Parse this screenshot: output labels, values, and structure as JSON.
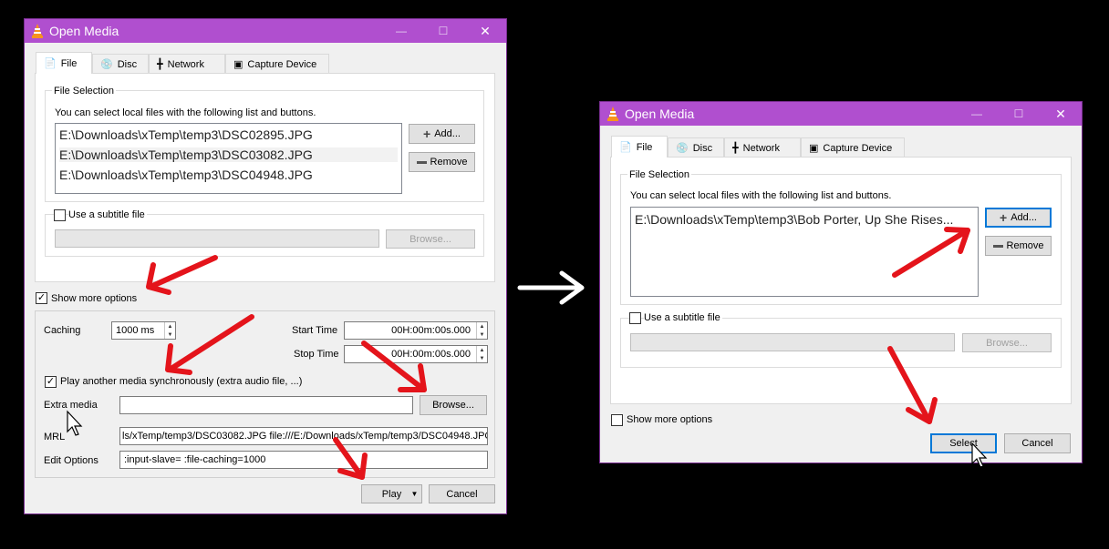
{
  "left": {
    "title": "Open Media",
    "tabs": [
      {
        "label": "File",
        "icon": "file-icon"
      },
      {
        "label": "Disc",
        "icon": "disc-icon"
      },
      {
        "label": "Network",
        "icon": "network-icon"
      },
      {
        "label": "Capture Device",
        "icon": "capture-device-icon"
      }
    ],
    "file_selection_label": "File Selection",
    "file_selection_hint": "You can select local files with the following list and buttons.",
    "files": [
      "E:\\Downloads\\xTemp\\temp3\\DSC02895.JPG",
      "E:\\Downloads\\xTemp\\temp3\\DSC03082.JPG",
      "E:\\Downloads\\xTemp\\temp3\\DSC04948.JPG"
    ],
    "add_label": "Add...",
    "remove_label": "Remove",
    "subtitle_label": "Use a subtitle file",
    "subtitle_browse_label": "Browse...",
    "show_more_label": "Show more options",
    "caching_label": "Caching",
    "caching_value": "1000 ms",
    "start_time_label": "Start Time",
    "start_time_value": "00H:00m:00s.000",
    "stop_time_label": "Stop Time",
    "stop_time_value": "00H:00m:00s.000",
    "play_sync_label": "Play another media synchronously (extra audio file, ...)",
    "extra_media_label": "Extra media",
    "extra_browse_label": "Browse...",
    "mrl_label": "MRL",
    "mrl_value": "ls/xTemp/temp3/DSC03082.JPG file:///E:/Downloads/xTemp/temp3/DSC04948.JPG",
    "edit_options_label": "Edit Options",
    "edit_options_value": ":input-slave= :file-caching=1000",
    "play_label": "Play",
    "cancel_label": "Cancel"
  },
  "right": {
    "title": "Open Media",
    "tabs": [
      {
        "label": "File",
        "icon": "file-icon"
      },
      {
        "label": "Disc",
        "icon": "disc-icon"
      },
      {
        "label": "Network",
        "icon": "network-icon"
      },
      {
        "label": "Capture Device",
        "icon": "capture-device-icon"
      }
    ],
    "file_selection_label": "File Selection",
    "file_selection_hint": "You can select local files with the following list and buttons.",
    "files": [
      "E:\\Downloads\\xTemp\\temp3\\Bob Porter, Up She Rises..."
    ],
    "add_label": "Add...",
    "remove_label": "Remove",
    "subtitle_label": "Use a subtitle file",
    "subtitle_browse_label": "Browse...",
    "show_more_label": "Show more options",
    "select_label": "Select",
    "cancel_label": "Cancel"
  },
  "colors": {
    "titlebar": "#b04fcf",
    "annotation_arrow": "#e4141b",
    "focus_border": "#0078d7"
  }
}
